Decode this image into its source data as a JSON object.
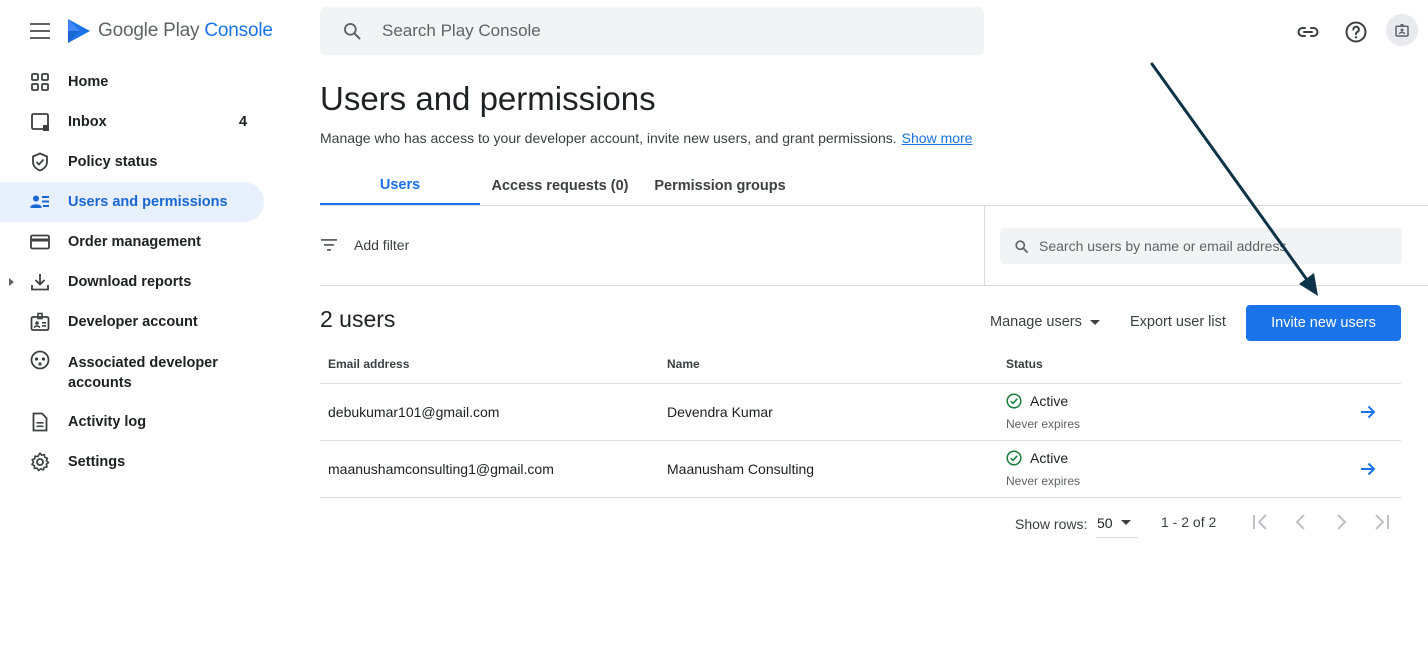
{
  "app": {
    "logo_text": "Google Play",
    "logo_accent": "Console"
  },
  "search": {
    "placeholder": "Search Play Console"
  },
  "sidebar": {
    "items": [
      {
        "label": "Home",
        "icon": "grid-icon"
      },
      {
        "label": "Inbox",
        "icon": "inbox-icon",
        "count": "4"
      },
      {
        "label": "Policy status",
        "icon": "shield-icon"
      },
      {
        "label": "Users and permissions",
        "icon": "users-icon",
        "active": true
      },
      {
        "label": "Order management",
        "icon": "credit-card-icon"
      },
      {
        "label": "Download reports",
        "icon": "download-icon"
      },
      {
        "label": "Developer account",
        "icon": "badge-icon"
      },
      {
        "label": "Associated developer accounts",
        "icon": "linked-accounts-icon"
      },
      {
        "label": "Activity log",
        "icon": "document-icon"
      },
      {
        "label": "Settings",
        "icon": "gear-icon"
      }
    ]
  },
  "page": {
    "title": "Users and permissions",
    "description": "Manage who has access to your developer account, invite new users, and grant permissions.",
    "show_more": "Show more"
  },
  "tabs": [
    {
      "label": "Users",
      "active": true
    },
    {
      "label": "Access requests (0)"
    },
    {
      "label": "Permission groups"
    }
  ],
  "filter": {
    "add_filter": "Add filter",
    "search_placeholder": "Search users by name or email address"
  },
  "users": {
    "count_label": "2 users",
    "manage_label": "Manage users",
    "export_label": "Export user list",
    "invite_label": "Invite new users",
    "columns": [
      "Email address",
      "Name",
      "Status"
    ],
    "rows": [
      {
        "email": "debukumar101@gmail.com",
        "name": "Devendra Kumar",
        "status": "Active",
        "expiry": "Never expires"
      },
      {
        "email": "maanushamconsulting1@gmail.com",
        "name": "Maanusham Consulting",
        "status": "Active",
        "expiry": "Never expires"
      }
    ]
  },
  "pagination": {
    "show_rows_label": "Show rows:",
    "rows_value": "50",
    "range": "1 - 2 of 2"
  },
  "colors": {
    "accent": "#1a73e8",
    "active_nav_bg": "#e8f0fe",
    "status_active": "#188038",
    "annotation_arrow": "#0d3349"
  }
}
